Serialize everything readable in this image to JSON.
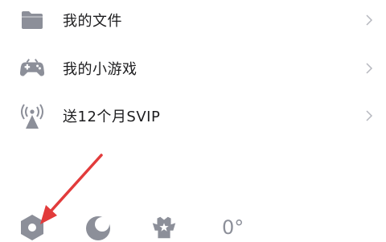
{
  "menu": {
    "items": [
      {
        "label": "我的文件",
        "icon": "folder-icon"
      },
      {
        "label": "我的小游戏",
        "icon": "gamepad-icon"
      },
      {
        "label": "送12个月SVIP",
        "icon": "broadcast-tower-icon"
      }
    ]
  },
  "bottom_bar": {
    "icons": [
      "settings-icon",
      "night-mode-moon-icon",
      "skin-badge-icon"
    ],
    "temperature": "0°"
  },
  "colors": {
    "icon_gray": "#8c8f99",
    "text": "#1c1c1e",
    "chevron": "#b6b8bf",
    "arrow": "#e23b3b"
  }
}
